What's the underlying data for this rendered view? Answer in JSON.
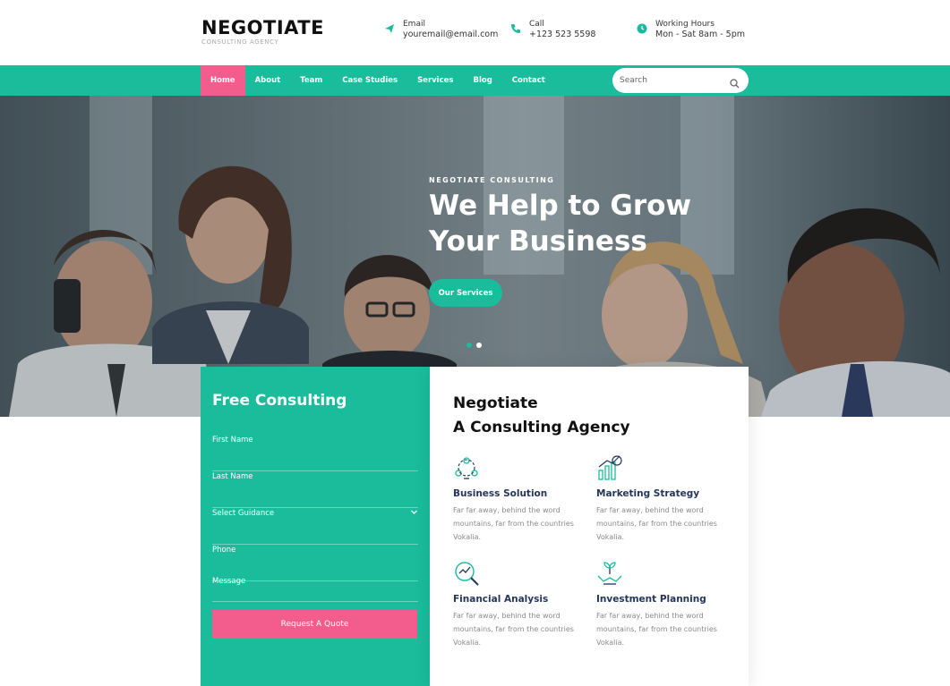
{
  "brand": {
    "name": "NEGOTIATE",
    "tagline": "CONSULTING AGENCY"
  },
  "contact": {
    "email": {
      "label": "Email",
      "value": "youremail@email.com",
      "icon": "paper-plane-icon"
    },
    "phone": {
      "label": "Call",
      "value": "+123 523 5598",
      "icon": "phone-icon"
    },
    "hours": {
      "label": "Working Hours",
      "value": "Mon - Sat 8am - 5pm",
      "icon": "clock-icon"
    }
  },
  "nav": {
    "items": [
      {
        "label": "Home",
        "active": true
      },
      {
        "label": "About"
      },
      {
        "label": "Team"
      },
      {
        "label": "Case Studies"
      },
      {
        "label": "Services"
      },
      {
        "label": "Blog"
      },
      {
        "label": "Contact"
      }
    ],
    "search_placeholder": "Search"
  },
  "hero": {
    "eyebrow": "NEGOTIATE CONSULTING",
    "title_line1": "We Help to Grow",
    "title_line2": "Your Business",
    "button": "Our Services",
    "slides": 2,
    "active_slide": 2
  },
  "form": {
    "title": "Free Consulting",
    "fields": {
      "first_name": "First Name",
      "last_name": "Last Name",
      "guidance": "Select Guidance",
      "phone": "Phone",
      "message": "Message"
    },
    "submit": "Request A Quote"
  },
  "services": {
    "heading_line1": "Negotiate",
    "heading_line2": "A Consulting Agency",
    "items": [
      {
        "title": "Business Solution",
        "text": "Far far away, behind the word mountains, far from the countries Vokalia.",
        "icon": "network-people-icon"
      },
      {
        "title": "Marketing Strategy",
        "text": "Far far away, behind the word mountains, far from the countries Vokalia.",
        "icon": "growth-chart-icon"
      },
      {
        "title": "Financial Analysis",
        "text": "Far far away, behind the word mountains, far from the countries Vokalia.",
        "icon": "magnifier-chart-icon"
      },
      {
        "title": "Investment Planning",
        "text": "Far far away, behind the word mountains, far from the countries Vokalia.",
        "icon": "plant-hand-icon"
      }
    ]
  },
  "colors": {
    "accent": "#1abc9c",
    "pink": "#f25d8e",
    "heading": "#24365c"
  }
}
